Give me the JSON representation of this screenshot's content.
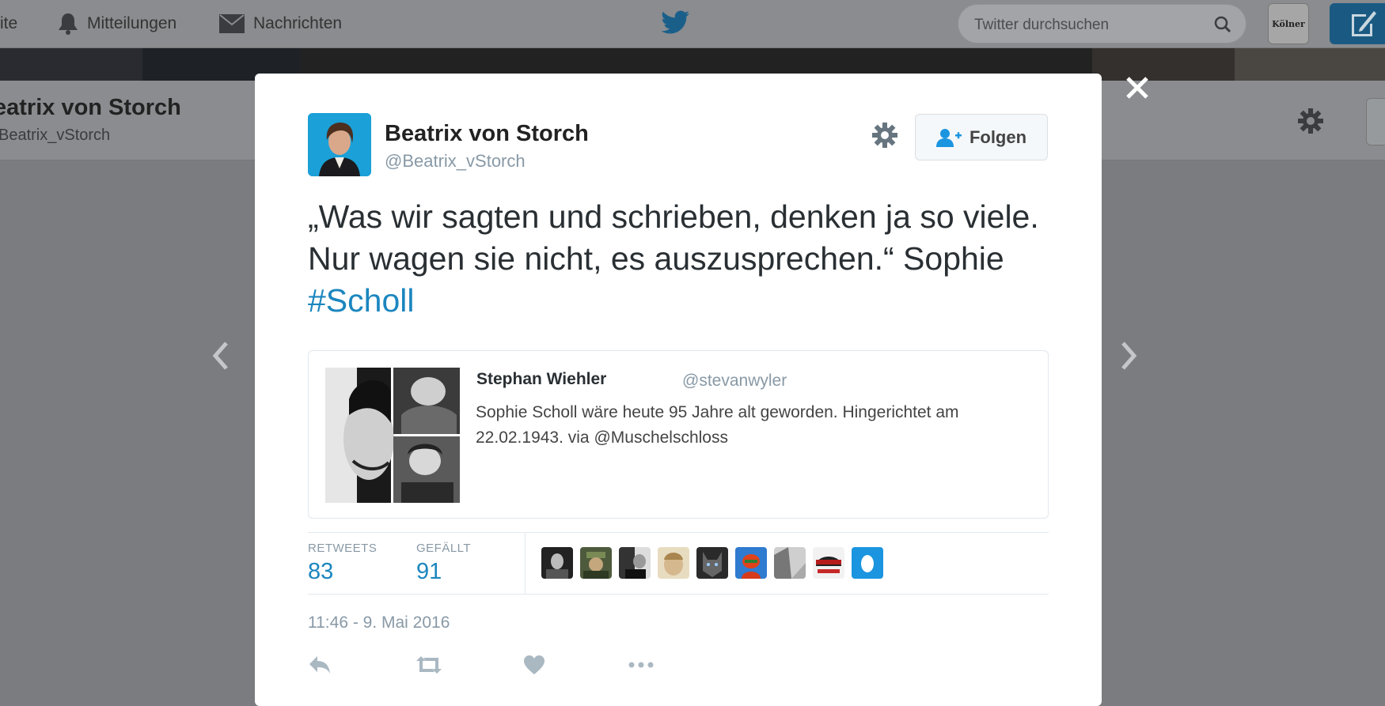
{
  "nav": {
    "home_label": "ite",
    "notifications_label": "Mitteilungen",
    "messages_label": "Nachrichten",
    "search_placeholder": "Twitter durchsuchen",
    "newspaper_label": "Kölner",
    "accent_color": "#1da1f2"
  },
  "profile_bar": {
    "name": "eatrix von Storch",
    "handle": "Beatrix_vStorch"
  },
  "tweet": {
    "author_name": "Beatrix von Storch",
    "author_handle": "@Beatrix_vStorch",
    "follow_label": "Folgen",
    "text_main": "„Was wir sagten und schrieben, denken ja so viele. Nur wagen sie nicht, es auszusprechen.“ Sophie ",
    "hashtag": "#Scholl",
    "quoted": {
      "name": "Stephan Wiehler",
      "handle": "@stevanwyler",
      "text": "Sophie Scholl wäre heute 95 Jahre alt geworden. Hingerichtet am 22.02.1943. via @Muschelschloss"
    },
    "stats": {
      "retweets_label": "RETWEETS",
      "retweets_value": "83",
      "likes_label": "GEFÄLLT",
      "likes_value": "91"
    },
    "timestamp": "11:46 - 9. Mai 2016"
  },
  "icons": [
    "bell-icon",
    "envelope-icon",
    "twitter-bird-icon",
    "search-icon",
    "compose-icon",
    "gear-icon",
    "follow-user-icon",
    "close-icon",
    "chevron-left-icon",
    "chevron-right-icon",
    "reply-icon",
    "retweet-icon",
    "heart-icon",
    "more-icon"
  ]
}
